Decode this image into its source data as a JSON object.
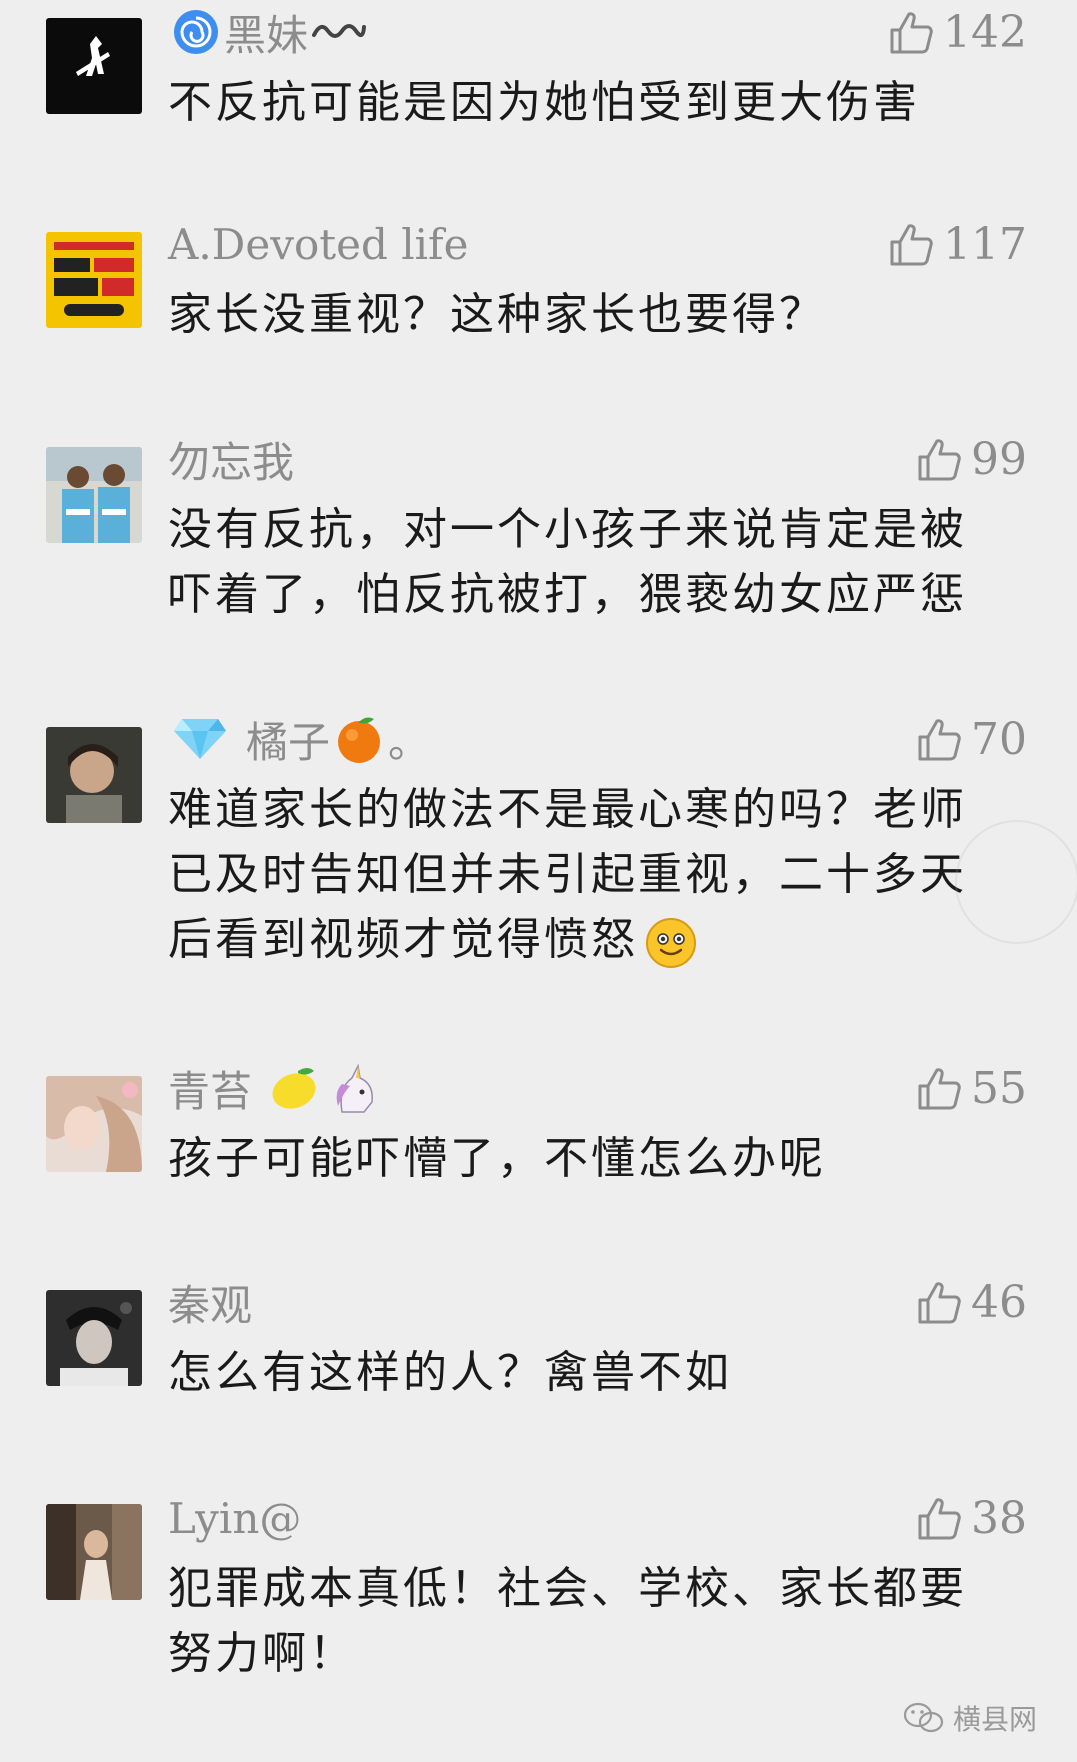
{
  "comments": [
    {
      "nickname": "黑妹",
      "nick_prefix_icon": "spiral-emoji",
      "nick_suffix_icon": "wave-emoji",
      "likes": "142",
      "lines": [
        "不反抗可能是因为她怕受到更大伤害"
      ]
    },
    {
      "nickname": "A.Devoted life",
      "likes": "117",
      "lines": [
        "家长没重视？这种家长也要得？"
      ]
    },
    {
      "nickname": "勿忘我",
      "likes": "99",
      "lines": [
        "没有反抗，对一个小孩子来说肯定是被",
        "吓着了，怕反抗被打，猥亵幼女应严惩"
      ]
    },
    {
      "nickname": "橘子",
      "nick_prefix_icon": "gem-emoji",
      "nick_suffix_icon": "tangerine-emoji",
      "nick_tail": "。",
      "likes": "70",
      "lines": [
        "难道家长的做法不是最心寒的吗？老师",
        "已及时告知但并未引起重视，二十多天",
        "后看到视频才觉得愤怒"
      ],
      "text_suffix_icon": "smile-emoji"
    },
    {
      "nickname": "青苔",
      "nick_suffix_icons": [
        "lemon-emoji",
        "unicorn-emoji"
      ],
      "likes": "55",
      "lines": [
        "孩子可能吓懵了，不懂怎么办呢"
      ]
    },
    {
      "nickname": "秦观",
      "likes": "46",
      "lines": [
        "怎么有这样的人？禽兽不如"
      ]
    },
    {
      "nickname": "Lyin@",
      "likes": "38",
      "lines": [
        "犯罪成本真低！社会、学校、家长都要",
        "努力啊！"
      ]
    }
  ],
  "watermark": {
    "label": "横县网",
    "icon": "wechat-icon"
  },
  "colors": {
    "background": "#eeeeee",
    "nickname": "#8c8c8c",
    "text": "#1a1a1a",
    "like": "#8c8c8c"
  }
}
